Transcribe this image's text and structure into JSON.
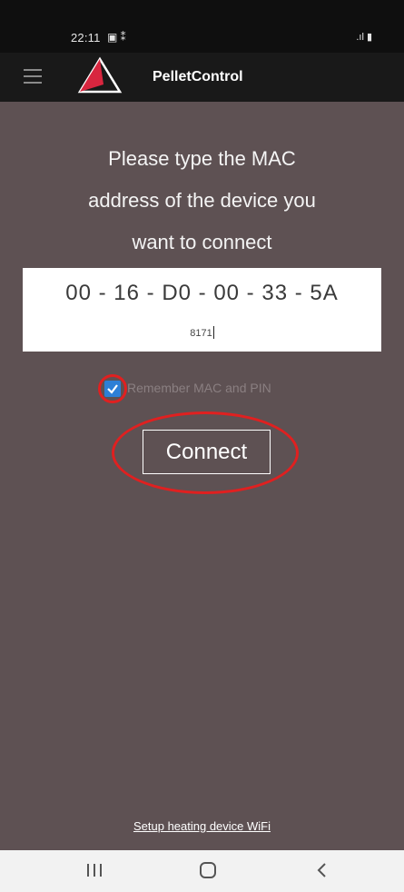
{
  "status_bar": {
    "time": "22:11",
    "left_icons": "▣ ⁑",
    "right_icons": ".ıl ▮"
  },
  "app_bar": {
    "title": "PelletControl",
    "menu_icon": "hamburger-menu-icon",
    "logo_icon": "pellet-triangle-logo",
    "accent_color": "#d8263f"
  },
  "main": {
    "instruction_lines": [
      "Please type the MAC",
      "address of the device you",
      "want to connect"
    ],
    "mac_address": "00 - 16 - D0 - 00 - 33 - 5A",
    "pin": "8171",
    "remember_checked": true,
    "remember_label": "Remember MAC and PIN",
    "connect_label": "Connect",
    "setup_link": "Setup heating device WiFi"
  },
  "nav_bar": {
    "recent_icon": "recent-apps-icon",
    "home_icon": "home-icon",
    "back_icon": "back-icon"
  },
  "colors": {
    "background": "#5e5153",
    "app_bar": "#191919",
    "status_bar": "#0f0f0f",
    "checkbox": "#2d7fd6",
    "highlight_ring": "#e02020"
  }
}
